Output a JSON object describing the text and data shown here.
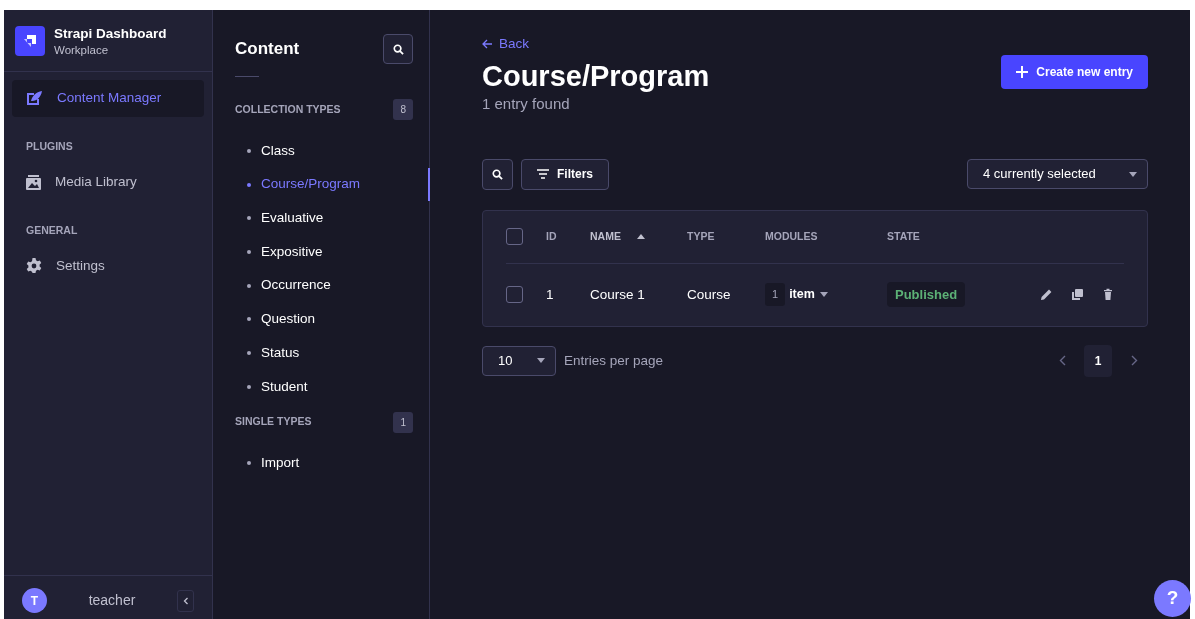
{
  "app": {
    "title": "Strapi Dashboard",
    "subtitle": "Workplace"
  },
  "main_nav": [
    {
      "items": [
        {
          "label": "Content Manager",
          "selected": true
        }
      ]
    },
    {
      "section": "PLUGINS",
      "items": [
        {
          "label": "Media Library",
          "selected": false
        }
      ]
    },
    {
      "section": "GENERAL",
      "items": [
        {
          "label": "Settings",
          "selected": false
        }
      ]
    }
  ],
  "user": {
    "initial": "T",
    "name": "teacher"
  },
  "content_nav": {
    "title": "Content",
    "groups": [
      {
        "label": "COLLECTION TYPES",
        "count": "8",
        "items": [
          {
            "label": "Class",
            "selected": false
          },
          {
            "label": "Course/Program",
            "selected": true
          },
          {
            "label": "Evaluative",
            "selected": false
          },
          {
            "label": "Expositive",
            "selected": false
          },
          {
            "label": "Occurrence",
            "selected": false
          },
          {
            "label": "Question",
            "selected": false
          },
          {
            "label": "Status",
            "selected": false
          },
          {
            "label": "Student",
            "selected": false
          }
        ]
      },
      {
        "label": "SINGLE TYPES",
        "count": "1",
        "items": [
          {
            "label": "Import",
            "selected": false
          }
        ]
      }
    ]
  },
  "page": {
    "back": "Back",
    "title": "Course/Program",
    "subtitle": "1 entry found",
    "create_button": "Create new entry",
    "filters_button": "Filters",
    "columns_select": "4 currently selected"
  },
  "table": {
    "all_checked": false,
    "columns": [
      {
        "label": "ID",
        "sorted": false
      },
      {
        "label": "NAME",
        "sorted": true
      },
      {
        "label": "TYPE",
        "sorted": false
      },
      {
        "label": "MODULES",
        "sorted": false
      },
      {
        "label": "STATE",
        "sorted": false
      }
    ],
    "rows": [
      {
        "checked": false,
        "id": "1",
        "name": "Course 1",
        "type": "Course",
        "modules_count": "1",
        "modules_label": "item",
        "state": "Published"
      }
    ]
  },
  "pagination": {
    "page_size": "10",
    "label": "Entries per page",
    "pages": [
      {
        "label": "1",
        "selected": true
      }
    ]
  },
  "help": "?"
}
